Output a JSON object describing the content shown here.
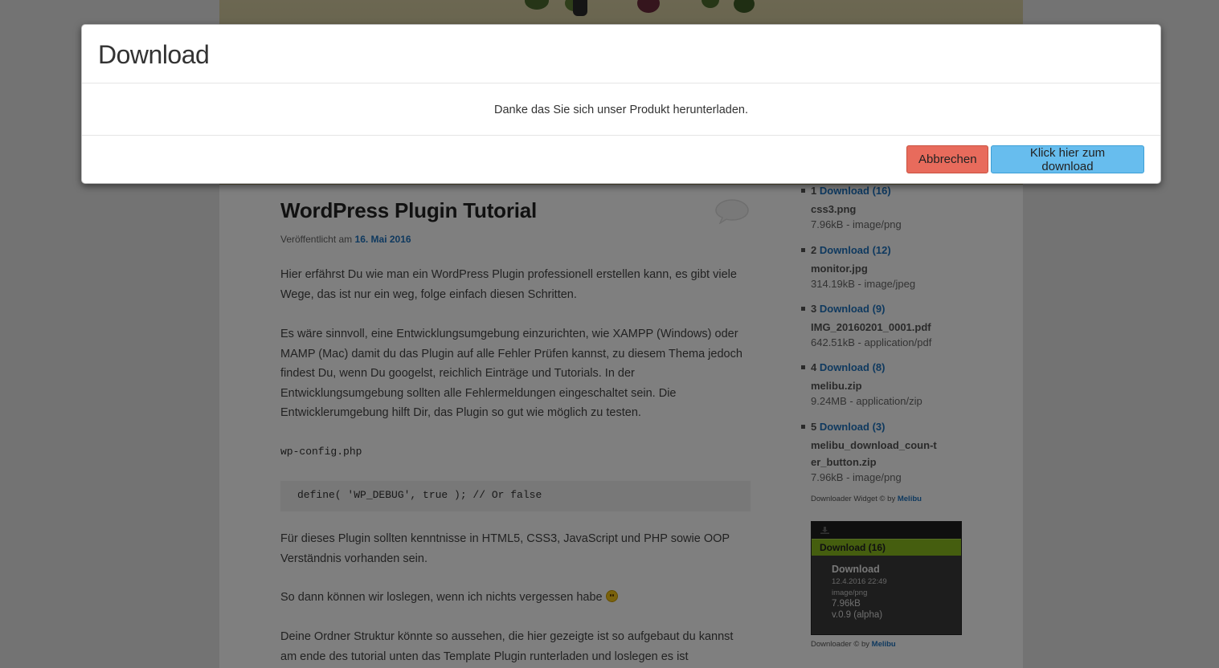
{
  "modal": {
    "title": "Download",
    "message": "Danke das Sie sich unser Produkt herunterladen.",
    "cancel_label": "Abbrechen",
    "download_label": "Klick hier zum download",
    "cancel_color": "#e86b5c",
    "download_color": "#67bdee"
  },
  "post": {
    "title": "WordPress Plugin Tutorial",
    "published_prefix": "Veröffentlicht am",
    "published_date": "16. Mai 2016",
    "p1": "Hier erfährst Du wie man ein WordPress Plugin professionell erstellen kann, es gibt viele Wege, das ist nur ein weg, folge einfach diesen Schritten.",
    "p2": "Es wäre sinnvoll, eine Entwicklungsumgebung einzurichten, wie XAMPP (Windows) oder MAMP (Mac) damit du das Plugin auf alle Fehler Prüfen kannst, zu diesem Thema jedoch findest Du, wenn Du googelst, reichlich Einträge und Tutorials. In der Entwicklungsumgebung sollten alle Fehlermeldungen eingeschaltet sein. Die Entwicklerumgebung hilft Dir, das Plugin so gut wie möglich zu testen.",
    "code_file": "wp-config.php",
    "code_line": "define( 'WP_DEBUG', true ); // Or false",
    "p3": "Für dieses Plugin sollten kenntnisse in HTML5, CSS3, JavaScript und PHP sowie OOP Verständnis vorhanden sein.",
    "p4": "So dann können wir loslegen, wenn ich nichts vergessen habe",
    "p5": "Deine Ordner Struktur könnte so aussehen, die hier gezeigte ist so aufgebaut du kannst am ende des tutorial unten das Template Plugin runterladen und loslegen es ist"
  },
  "sidebar": {
    "downloads": [
      {
        "num": "1",
        "link": "Download (16)",
        "name": "css3.png",
        "meta": "7.96kB - image/png"
      },
      {
        "num": "2",
        "link": "Download (12)",
        "name": "monitor.jpg",
        "meta": "314.19kB - image/jpeg"
      },
      {
        "num": "3",
        "link": "Download (9)",
        "name": "IMG_20160201_0001.pdf",
        "meta": "642.51kB - application/pdf"
      },
      {
        "num": "4",
        "link": "Download (8)",
        "name": "melibu.zip",
        "meta": "9.24MB - application/zip"
      },
      {
        "num": "5",
        "link": "Download (3)",
        "name": "melibu_download_coun-ter_button.zip",
        "meta": "7.96kB - image/png"
      }
    ],
    "credit1_prefix": "Downloader Widget © by",
    "credit1_link": "Melibu",
    "widget": {
      "bar_label": "Download (16)",
      "title": "Download",
      "date": "12.4.2016 22:49",
      "type": "image/png",
      "size": "7.96kB",
      "version": "v.0.9 (alpha)",
      "bar_color": "#8bbd1e"
    },
    "credit2_prefix": "Downloader © by",
    "credit2_link": "Melibu"
  }
}
